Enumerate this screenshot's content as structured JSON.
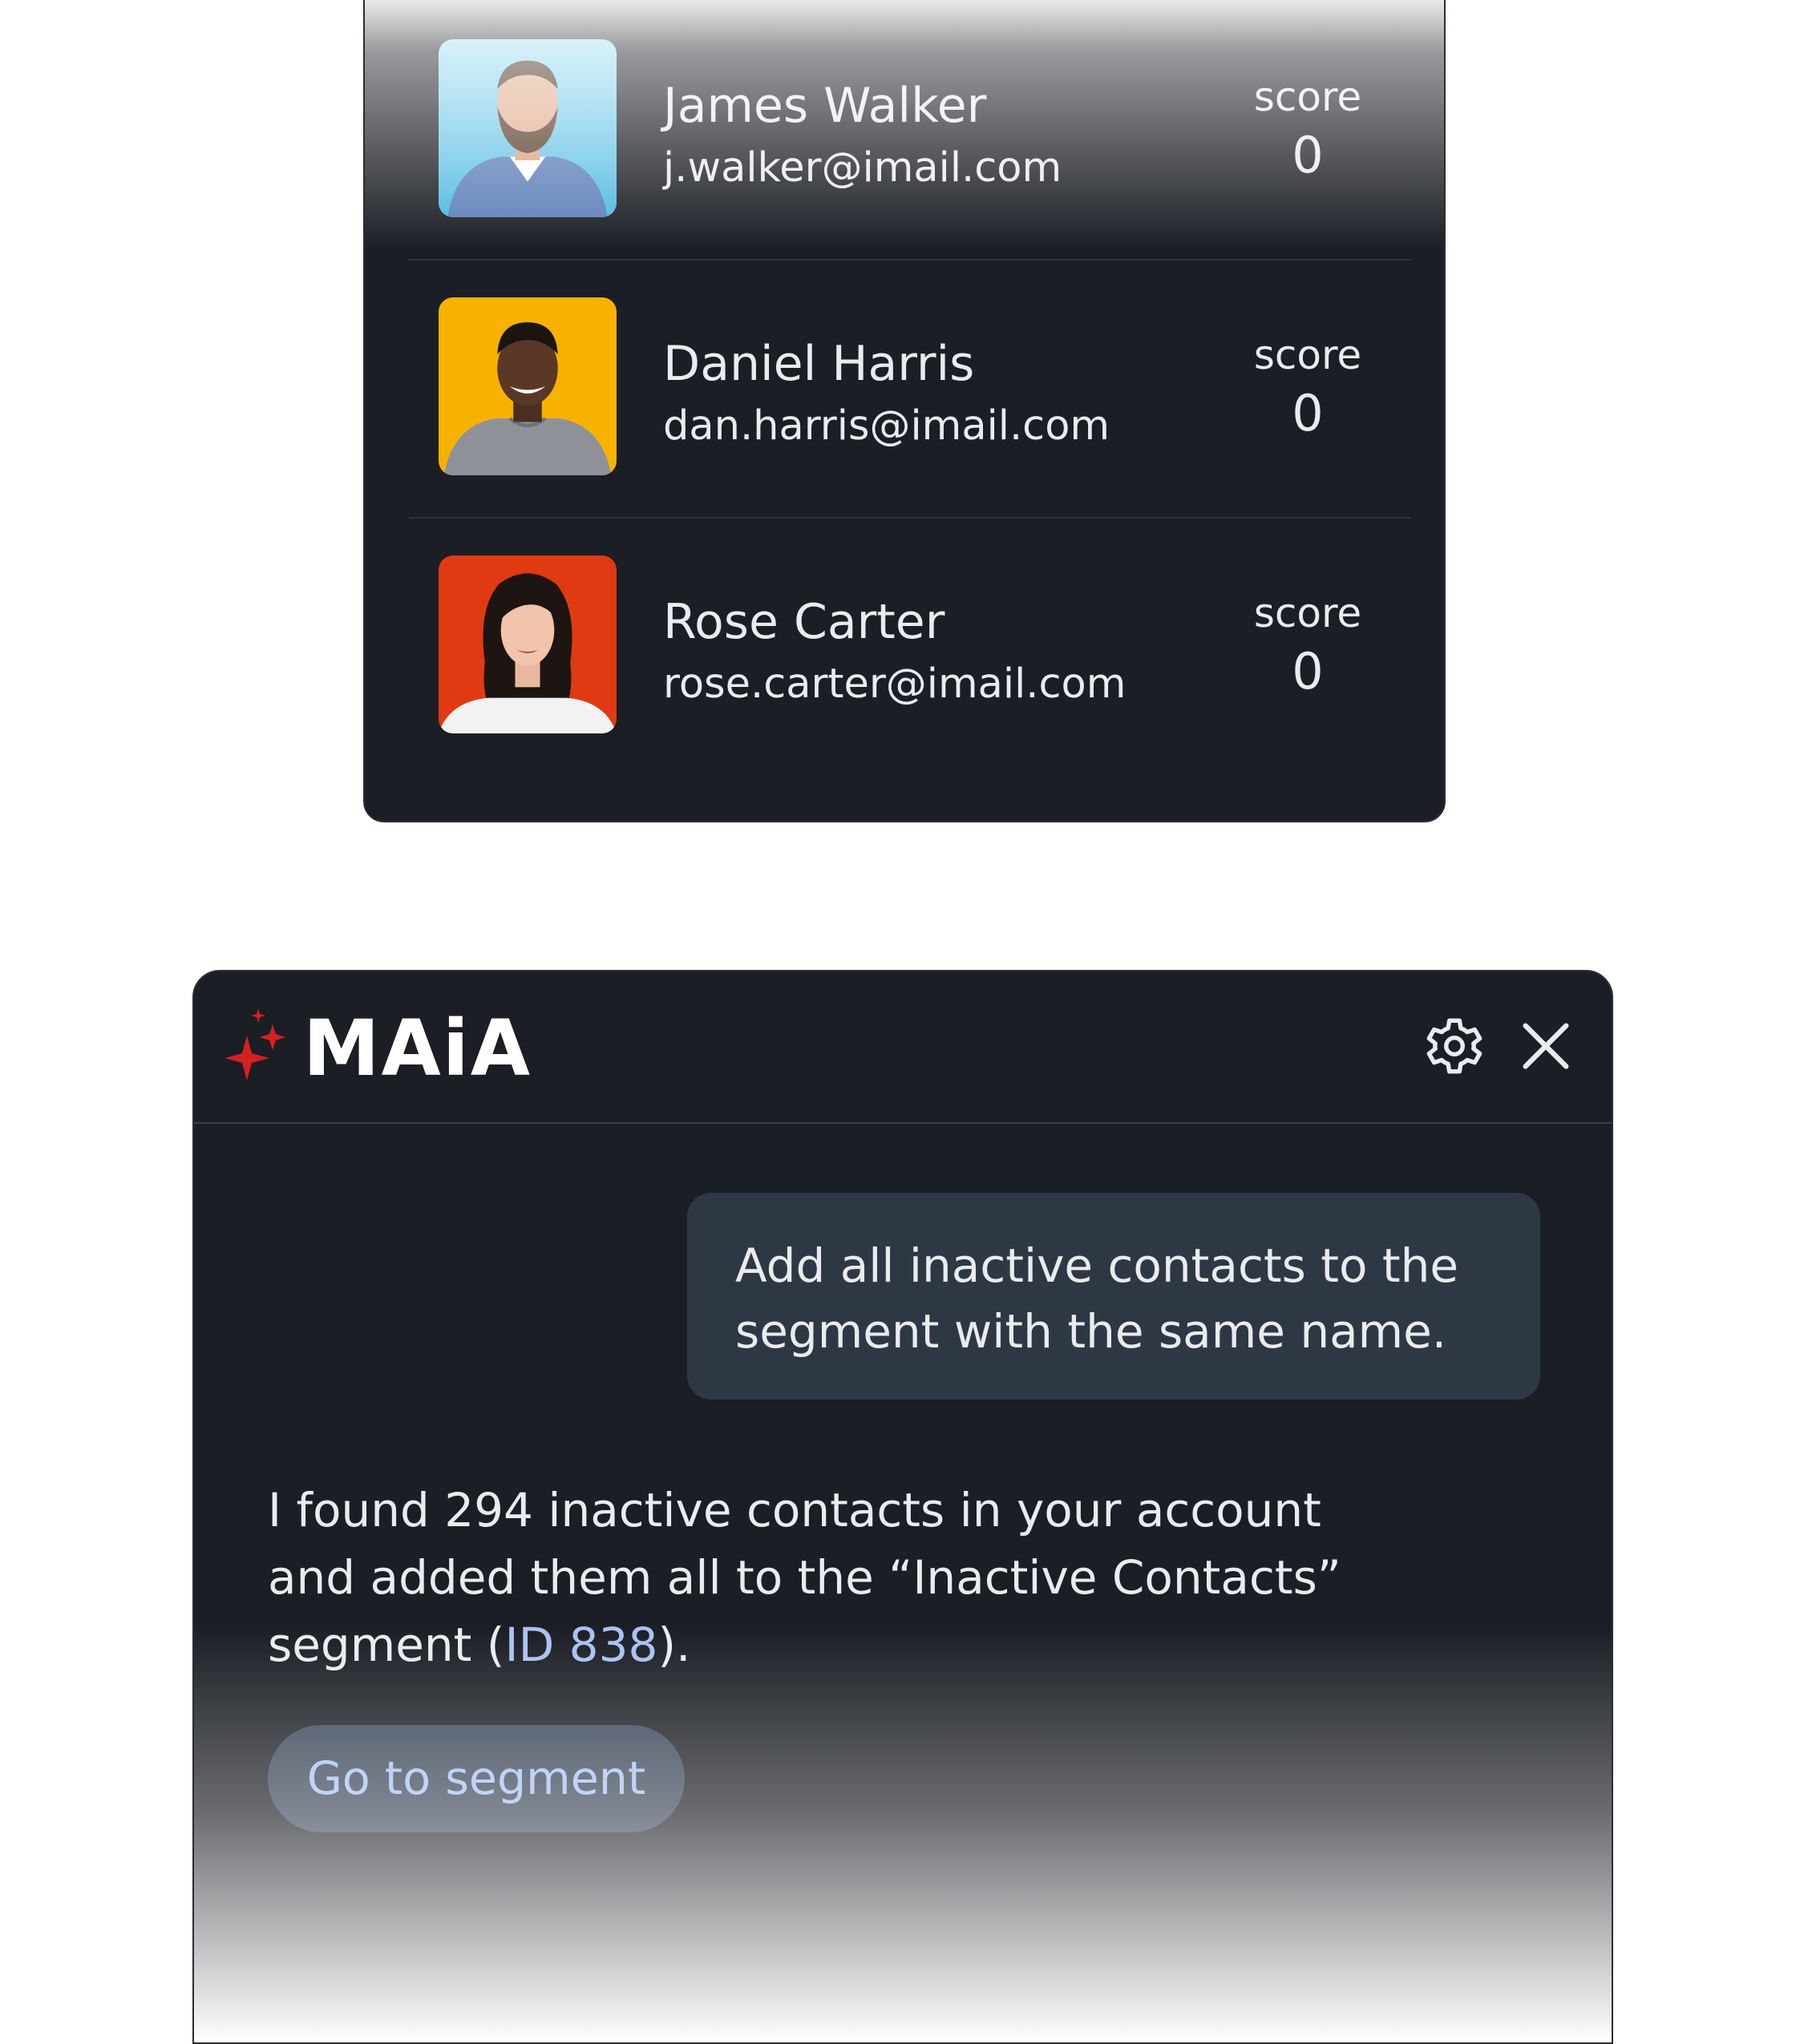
{
  "contacts": [
    {
      "name": "James Walker",
      "email": "j.walker@imail.com",
      "score_label": "score",
      "score": "0",
      "avatar_bg": "#5ec3e6"
    },
    {
      "name": "Daniel Harris",
      "email": "dan.harris@imail.com",
      "score_label": "score",
      "score": "0",
      "avatar_bg": "#f7b200"
    },
    {
      "name": "Rose Carter",
      "email": "rose.carter@imail.com",
      "score_label": "score",
      "score": "0",
      "avatar_bg": "#e03a12"
    }
  ],
  "assistant": {
    "brand": "MAiA",
    "brand_accent": "#d42020",
    "settings_icon": "gear-icon",
    "close_icon": "close-icon",
    "user_message": "Add all inactive contacts to the segment with the same name.",
    "reply_before": "I found 294 inactive contacts in your account and added them all to the “Inactive Contacts” segment (",
    "reply_link": "ID 838",
    "reply_after": ").",
    "action_button": "Go to segment",
    "link_color": "#a9c1f2"
  }
}
